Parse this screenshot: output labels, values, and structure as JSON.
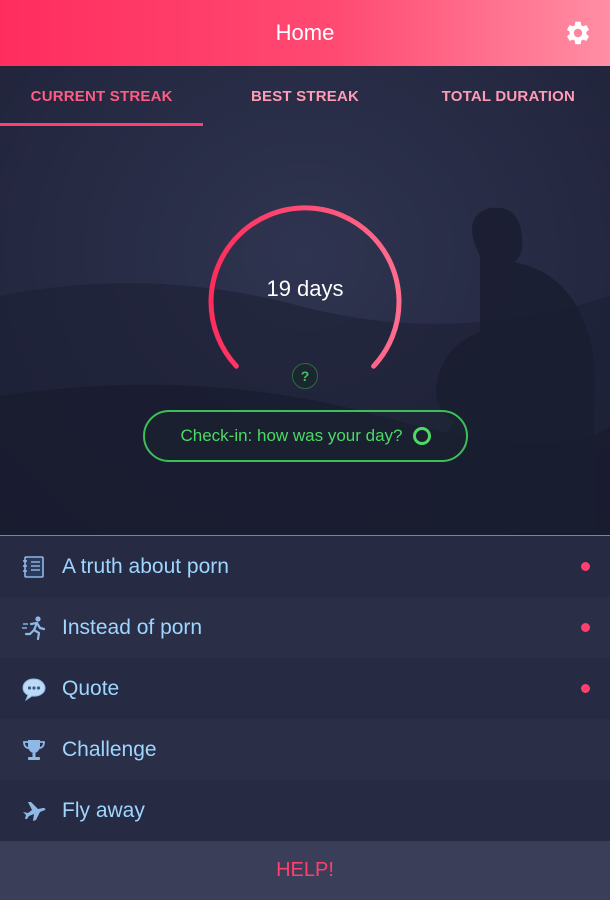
{
  "appbar": {
    "title": "Home",
    "settings_icon": "gear-icon"
  },
  "tabs": [
    {
      "label": "CURRENT STREAK",
      "active": true
    },
    {
      "label": "BEST STREAK",
      "active": false
    },
    {
      "label": "TOTAL DURATION",
      "active": false
    }
  ],
  "streak": {
    "value": "19 days",
    "help": "?"
  },
  "checkin": {
    "label": "Check-in: how was your day?"
  },
  "menu": {
    "items": [
      {
        "label": "A truth about porn",
        "icon": "notebook-icon",
        "unread": true
      },
      {
        "label": "Instead of porn",
        "icon": "running-person-icon",
        "unread": true
      },
      {
        "label": "Quote",
        "icon": "speech-bubble-icon",
        "unread": true
      },
      {
        "label": "Challenge",
        "icon": "trophy-icon",
        "unread": false
      },
      {
        "label": "Fly away",
        "icon": "airplane-icon",
        "unread": false
      }
    ]
  },
  "help": {
    "label": "HELP!"
  },
  "colors": {
    "accent": "#ff3f6e",
    "green": "#4cd964",
    "menu_text": "#9ed6ff",
    "background": "#1f2238"
  }
}
